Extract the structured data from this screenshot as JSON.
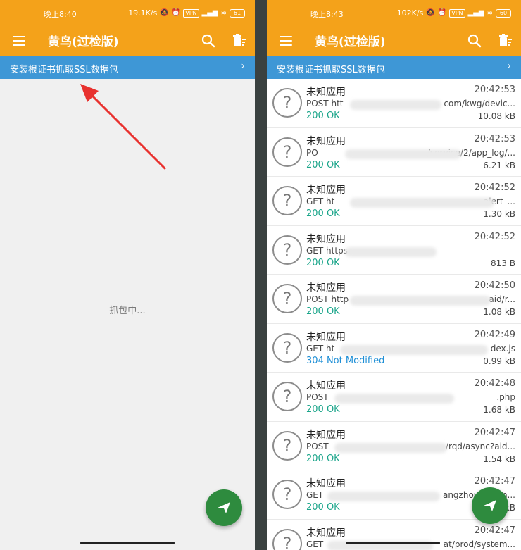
{
  "status_left": {
    "time": "晚上8:40",
    "speed": "19.1K/s",
    "battery": "61"
  },
  "status_right": {
    "time": "晚上8:43",
    "speed": "102K/s",
    "battery": "60"
  },
  "status_vpn": "VPN",
  "app": {
    "title": "黄鸟(过检版)",
    "accent": "#f4a21a"
  },
  "banner": {
    "text": "安装根证书抓取SSL数据包",
    "chevron": "›",
    "color": "#3e97d6"
  },
  "empty_state": {
    "text": "抓包中..."
  },
  "colors": {
    "ok": "#1aa58a",
    "not_modified": "#1e8fd6",
    "fab": "#2e8b3e"
  },
  "requests": [
    {
      "app": "未知应用",
      "time": "20:42:53",
      "method": "POST",
      "url_start": "htt",
      "url_end": "com/kwg/devic...",
      "status": "200 OK",
      "size": "10.08 kB"
    },
    {
      "app": "未知应用",
      "time": "20:42:53",
      "method": "PO",
      "url_start": "",
      "url_end": "/service/2/app_log/...",
      "status": "200 OK",
      "size": "6.21 kB"
    },
    {
      "app": "未知应用",
      "time": "20:42:52",
      "method": "GET",
      "url_start": "ht",
      "url_end": "alert_...",
      "status": "200 OK",
      "size": "1.30 kB"
    },
    {
      "app": "未知应用",
      "time": "20:42:52",
      "method": "GET",
      "url_start": "https",
      "url_end": "",
      "status": "200 OK",
      "size": "813 B"
    },
    {
      "app": "未知应用",
      "time": "20:42:50",
      "method": "POST",
      "url_start": "http",
      "url_end": "aid/r...",
      "status": "200 OK",
      "size": "1.08 kB"
    },
    {
      "app": "未知应用",
      "time": "20:42:49",
      "method": "GET",
      "url_start": "ht",
      "url_end": "dex.js",
      "status": "304 Not Modified",
      "size": "0.99 kB"
    },
    {
      "app": "未知应用",
      "time": "20:42:48",
      "method": "POST",
      "url_start": "",
      "url_end": ".php",
      "status": "200 OK",
      "size": "1.68 kB"
    },
    {
      "app": "未知应用",
      "time": "20:42:47",
      "method": "POST",
      "url_start": "",
      "url_end": "/rqd/async?aid...",
      "status": "200 OK",
      "size": "1.54 kB"
    },
    {
      "app": "未知应用",
      "time": "20:42:47",
      "method": "GET",
      "url_start": "",
      "url_end": "angzhou.aliyun...",
      "status": "200 OK",
      "size": "1.13 kB"
    },
    {
      "app": "未知应用",
      "time": "20:42:47",
      "method": "GET",
      "url_start": "",
      "url_end": "at/prod/system...",
      "status": "",
      "size": ""
    }
  ]
}
